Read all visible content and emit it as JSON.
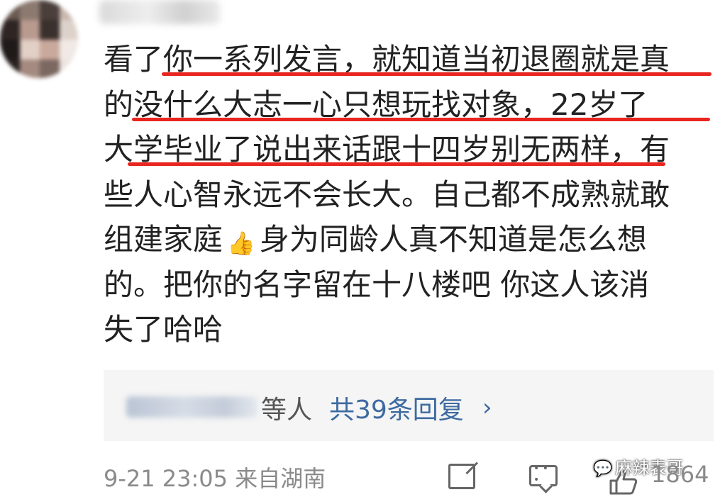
{
  "comment": {
    "lines": [
      "看了你一系列发言，就知道当初退圈就是真",
      "的没什么大志一心只想玩找对象，22岁了",
      "大学毕业了说出来话跟十四岁别无两样，有",
      "些人心智永远不会长大。自己都不成熟就敢",
      "组建家庭",
      "身为同龄人真不知道是怎么想",
      "的。把你的名字留在十八楼吧 你这人该消",
      "失了哈哈"
    ],
    "inline_emoji": "👍"
  },
  "replies": {
    "suffix": "等人",
    "count_label": "共39条回复",
    "chevron": "›"
  },
  "meta": {
    "timestamp_location": "9-21 23:05 来自湖南",
    "like_count": "1864"
  },
  "watermark": {
    "text": "麻辣表哥",
    "icon": "wechat-icon"
  },
  "colors": {
    "text": "#222222",
    "underline_red": "#e8251f",
    "link_blue": "#3d6aa1",
    "meta_gray": "#8a8a8a",
    "reply_bg": "#f5f5f5"
  }
}
